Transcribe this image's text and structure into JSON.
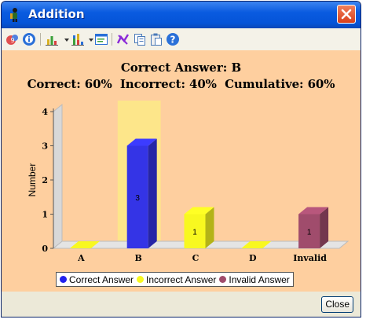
{
  "window": {
    "title": "Addition",
    "close_label": "Close"
  },
  "toolbar": {
    "items": [
      "share-icon",
      "info-icon",
      "bar-chart-icon",
      "stacked-chart-icon",
      "form-icon",
      "chart-options-icon",
      "copy-icon",
      "paste-icon",
      "help-icon"
    ]
  },
  "chart_data": {
    "type": "bar",
    "title": "Correct Answer: B",
    "subtitle": "Correct: 60%  Incorrect: 40%  Cumulative: 60%",
    "ylabel": "Number",
    "xlabel": "",
    "categories": [
      "A",
      "B",
      "C",
      "D",
      "Invalid"
    ],
    "values": [
      0,
      3,
      1,
      0,
      1
    ],
    "bar_types": [
      "incorrect",
      "correct",
      "incorrect",
      "incorrect",
      "invalid"
    ],
    "highlight_category": "B",
    "ylim": [
      0,
      4
    ],
    "yticks": [
      0,
      1,
      2,
      3,
      4
    ],
    "data_labels": [
      "",
      "3",
      "1",
      "",
      "1"
    ],
    "legend": [
      "Correct Answer",
      "Incorrect Answer",
      "Invalid Answer"
    ],
    "legend_position": "bottom",
    "colors": {
      "correct": "#3434e6",
      "incorrect": "#f8f820",
      "invalid": "#a04c6c",
      "highlight": "#fde68a",
      "background": "#fecf9f"
    }
  }
}
